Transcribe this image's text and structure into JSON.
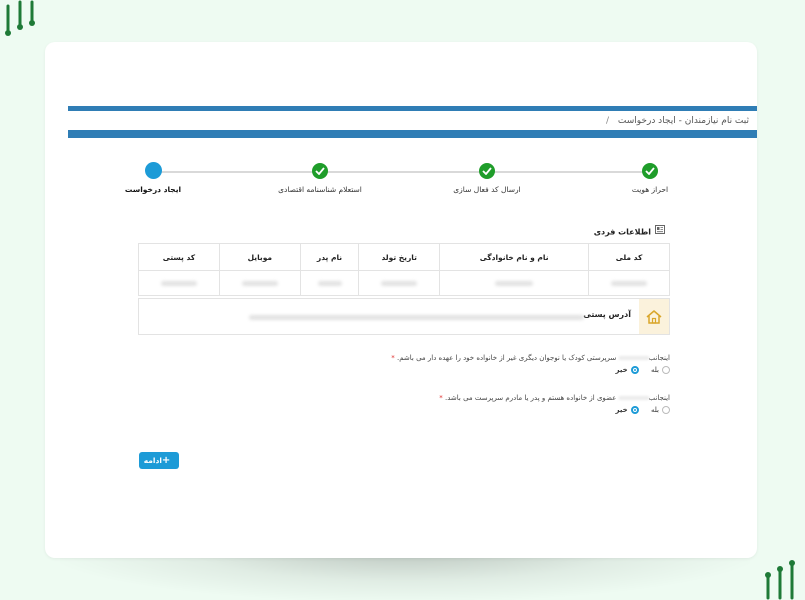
{
  "breadcrumb": {
    "text": "ثبت نام نیازمندان - ایجاد درخواست",
    "separator": "/"
  },
  "stepper": {
    "steps": [
      {
        "label": "احراز هویت",
        "status": "done"
      },
      {
        "label": "ارسال کد فعال سازی",
        "status": "done"
      },
      {
        "label": "استعلام شناسنامه اقتصادی",
        "status": "done"
      },
      {
        "label": "ایجاد درخواست",
        "status": "current"
      }
    ]
  },
  "personal_info": {
    "title": "اطلاعات فردی",
    "columns": [
      "کد ملی",
      "نام و نام خانوادگی",
      "تاریخ تولد",
      "نام پدر",
      "موبایل",
      "کد پستی"
    ]
  },
  "address": {
    "label": "آدرس پستی"
  },
  "questions": [
    {
      "prefix": "اینجانب",
      "text": "سرپرستی کودک یا نوجوان دیگری غیر از خانواده خود را عهده دار می باشم.",
      "required": "*",
      "options": [
        "بله",
        "خیر"
      ],
      "selected": "خیر"
    },
    {
      "prefix": "اینجانب",
      "text": "عضوی از خانواده هستم و پدر یا مادرم سرپرست می باشد.",
      "required": "*",
      "options": [
        "بله",
        "خیر"
      ],
      "selected": "خیر"
    }
  ],
  "continue_button": {
    "label": "ادامه",
    "icon": "plus-icon"
  },
  "colors": {
    "primary_blue": "#2f7db5",
    "accent_blue": "#1d9bd7",
    "success_green": "#1f9d2a",
    "background": "#eefbf2"
  }
}
